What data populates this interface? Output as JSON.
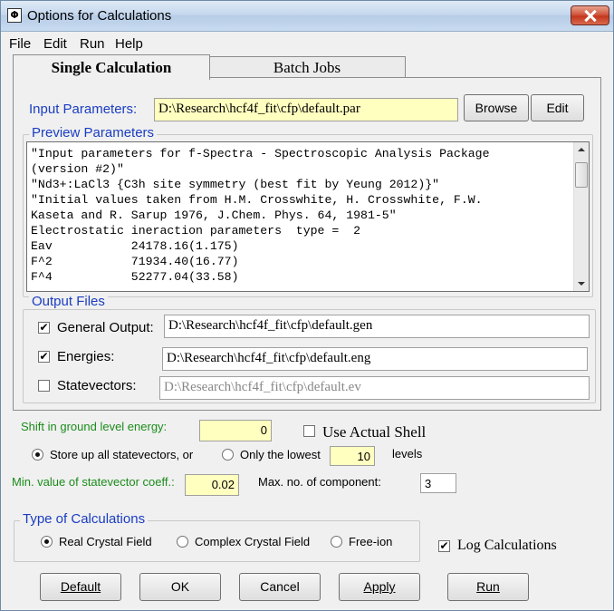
{
  "window": {
    "title": "Options for Calculations",
    "icon_symbol": "Φ"
  },
  "menu": [
    {
      "label": "File",
      "accel": "F"
    },
    {
      "label": "Edit",
      "accel": "E"
    },
    {
      "label": "Run",
      "accel": "R"
    },
    {
      "label": "Help",
      "accel": "H"
    }
  ],
  "tabs": {
    "single": "Single Calculation",
    "batch": "Batch Jobs"
  },
  "input_params": {
    "label": "Input Parameters:",
    "value": "D:\\Research\\hcf4f_fit\\cfp\\default.par",
    "browse": "Browse",
    "edit": "Edit"
  },
  "preview": {
    "title": "Preview Parameters",
    "text": "\"Input parameters for f-Spectra - Spectroscopic Analysis Package\n(version #2)\"\n\"Nd3+:LaCl3 {C3h site symmetry (best fit by Yeung 2012)}\"\n\"Initial values taken from H.M. Crosswhite, H. Crosswhite, F.W.\nKaseta and R. Sarup 1976, J.Chem. Phys. 64, 1981-5\"\nElectrostatic ineraction parameters  type =  2\nEav           24178.16(1.175)\nF^2           71934.40(16.77)\nF^4           52277.04(33.58)"
  },
  "output_files": {
    "title": "Output Files",
    "general": {
      "label": "General Output:",
      "value": "D:\\Research\\hcf4f_fit\\cfp\\default.gen",
      "checked": true
    },
    "energies": {
      "label": "Energies:",
      "value": "D:\\Research\\hcf4f_fit\\cfp\\default.eng",
      "checked": true
    },
    "statevectors": {
      "label": "Statevectors:",
      "value": "D:\\Research\\hcf4f_fit\\cfp\\default.ev",
      "checked": false
    }
  },
  "options": {
    "shift_label": "Shift in ground level energy:",
    "shift_value": "0",
    "use_actual_shell": "Use Actual Shell",
    "store_all": "Store up all statevectors,  or",
    "only_lowest": "Only the lowest",
    "lowest_value": "10",
    "levels": "levels",
    "min_coeff_label": "Min. value of statevector coeff.:",
    "min_coeff_value": "0.02",
    "max_comp_label": "Max. no. of component:",
    "max_comp_value": "3"
  },
  "type_of_calc": {
    "title": "Type of Calculations",
    "real": "Real Crystal Field",
    "complex": "Complex Crystal Field",
    "free_ion": "Free-ion",
    "selected": "real"
  },
  "log_calculations": {
    "label": "Log Calculations",
    "checked": true
  },
  "buttons": {
    "default": "Default",
    "ok": "OK",
    "cancel": "Cancel",
    "apply": "Apply",
    "run": "Run"
  },
  "check_glyph": "✔"
}
